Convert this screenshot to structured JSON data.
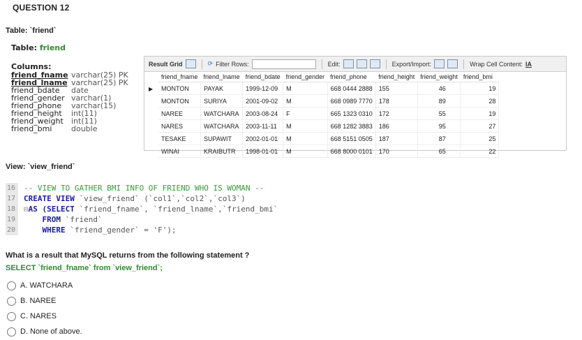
{
  "question": {
    "title": "QUESTION 12"
  },
  "table_label": {
    "prefix": "Table: ",
    "name": "`friend`"
  },
  "schema": {
    "title_prefix": "Table: ",
    "title_name": "friend",
    "columns_heading": "Columns:",
    "columns": [
      {
        "name": "friend_fname",
        "type": "varchar(25) PK",
        "pk": true
      },
      {
        "name": "friend_lname",
        "type": "varchar(25) PK",
        "pk": true
      },
      {
        "name": "friend_bdate",
        "type": "date",
        "pk": false
      },
      {
        "name": "friend_gender",
        "type": "varchar(1)",
        "pk": false
      },
      {
        "name": "friend_phone",
        "type": "varchar(15)",
        "pk": false
      },
      {
        "name": "friend_height",
        "type": "int(11)",
        "pk": false
      },
      {
        "name": "friend_weight",
        "type": "int(11)",
        "pk": false
      },
      {
        "name": "friend_bmi",
        "type": "double",
        "pk": false
      }
    ]
  },
  "grid": {
    "toolbar": {
      "result_grid": "Result Grid",
      "filter_rows": "Filter Rows:",
      "edit": "Edit:",
      "export_import": "Export/Import:",
      "wrap_cell": "Wrap Cell Content:"
    },
    "headers": [
      "friend_fname",
      "friend_lname",
      "friend_bdate",
      "friend_gender",
      "friend_phone",
      "friend_height",
      "friend_weight",
      "friend_bmi"
    ],
    "rows": [
      [
        "MONTON",
        "PAYAK",
        "1999-12-09",
        "M",
        "668 0444 2888",
        "155",
        "46",
        "19"
      ],
      [
        "MONTON",
        "SURIYA",
        "2001-09-02",
        "M",
        "668 0989 7770",
        "178",
        "89",
        "28"
      ],
      [
        "NAREE",
        "WATCHARA",
        "2003-08-24",
        "F",
        "665 1323 0310",
        "172",
        "55",
        "19"
      ],
      [
        "NARES",
        "WATCHARA",
        "2003-11-11",
        "M",
        "668 1282 3883",
        "186",
        "95",
        "27"
      ],
      [
        "TESAKE",
        "SUPAWIT",
        "2002-01-01",
        "M",
        "668 5151 0505",
        "187",
        "87",
        "25"
      ],
      [
        "WINAI",
        "KRAIBUTR",
        "1998-01-01",
        "M",
        "668 8000 0101",
        "170",
        "65",
        "22"
      ]
    ]
  },
  "view_label": {
    "prefix": "View: ",
    "name": "`view_friend`"
  },
  "code": {
    "lines": [
      {
        "num": "16",
        "text": "-- VIEW TO GATHER BMI INFO OF FRIEND WHO IS WOMAN --"
      },
      {
        "num": "17",
        "kw": "CREATE VIEW",
        "text": " `view_friend` (`col1`,`col2`,`col3`)"
      },
      {
        "num": "18",
        "kw": "AS (SELECT",
        "text": " `friend_fname`, `friend_lname`,`friend_bmi`"
      },
      {
        "num": "19",
        "kw": "FROM",
        "text": " `friend`"
      },
      {
        "num": "20",
        "kw": "WHERE",
        "text": " `friend_gender` = 'F');"
      }
    ]
  },
  "prompt": {
    "question": "What is a result that MySQL returns from the following statement ?",
    "statement": "SELECT `friend_fname` from `view_friend`;"
  },
  "options": [
    {
      "label": "A. WATCHARA"
    },
    {
      "label": "B. NAREE"
    },
    {
      "label": "C. NARES"
    },
    {
      "label": "D. None of above."
    }
  ],
  "colors": {
    "accent_green": "#2e8b2e",
    "keyword_blue": "#1a1aa6",
    "comment_green": "#3a9a3a"
  }
}
